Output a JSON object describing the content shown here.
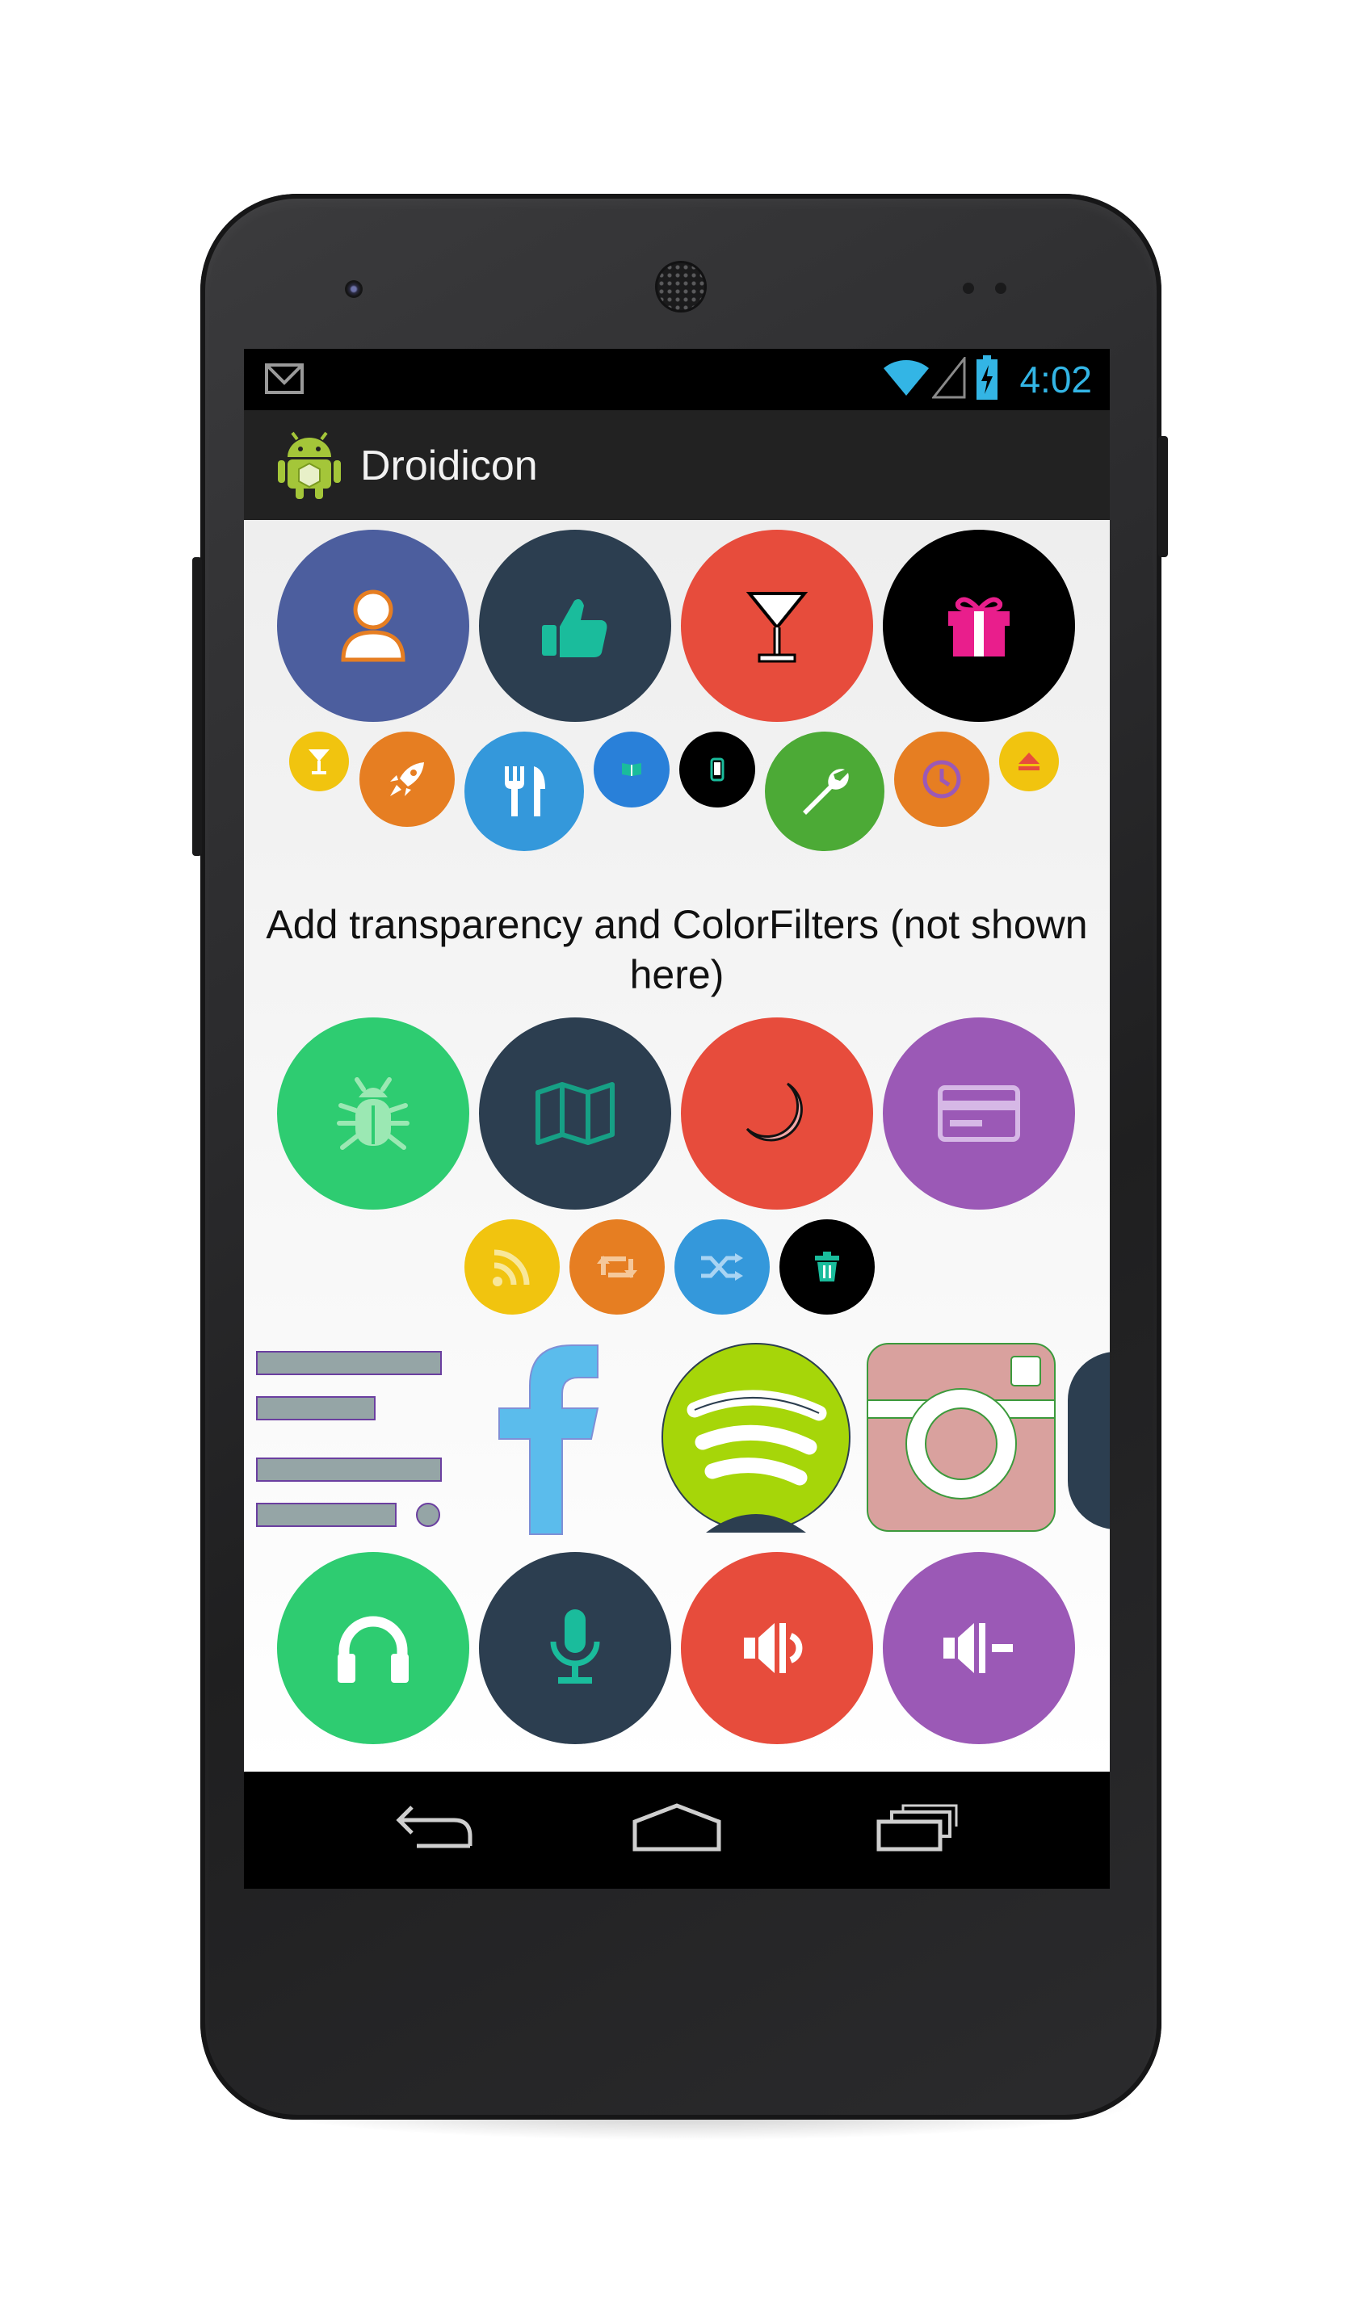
{
  "status_bar": {
    "notification_icon": "gmail-icon",
    "icons": [
      "wifi-icon",
      "signal-icon",
      "battery-charging-icon"
    ],
    "time": "4:02",
    "time_color": "#33b5e5"
  },
  "action_bar": {
    "app_icon": "android-robot-icon",
    "title": "Droidicon"
  },
  "main": {
    "caption": "Add transparency and ColorFilters (not shown here)",
    "rows": {
      "large_row_1": [
        {
          "icon": "user-icon",
          "bg": "#4c5e9e"
        },
        {
          "icon": "thumbs-up-icon",
          "bg": "#2c3e50"
        },
        {
          "icon": "cocktail-icon",
          "bg": "#e74c3c"
        },
        {
          "icon": "gift-icon",
          "bg": "#000000"
        }
      ],
      "small_row_1": [
        {
          "icon": "cocktail-icon",
          "bg": "#f1c40f"
        },
        {
          "icon": "rocket-icon",
          "bg": "#e67e22"
        },
        {
          "icon": "cutlery-icon",
          "bg": "#3498db"
        },
        {
          "icon": "book-icon",
          "bg": "#2980d9"
        },
        {
          "icon": "mobile-icon",
          "bg": "#000000"
        },
        {
          "icon": "wrench-icon",
          "bg": "#4caa36"
        },
        {
          "icon": "clock-icon",
          "bg": "#e67e22"
        },
        {
          "icon": "eject-icon",
          "bg": "#f1c40f"
        }
      ],
      "large_row_2": [
        {
          "icon": "bug-icon",
          "bg": "#2ecc71"
        },
        {
          "icon": "map-icon",
          "bg": "#2c3e50"
        },
        {
          "icon": "moon-icon",
          "bg": "#e74c3c"
        },
        {
          "icon": "credit-card-icon",
          "bg": "#9b59b6"
        }
      ],
      "small_row_2": [
        {
          "icon": "rss-icon",
          "bg": "#f1c40f"
        },
        {
          "icon": "retweet-icon",
          "bg": "#e67e22"
        },
        {
          "icon": "shuffle-icon",
          "bg": "#3498db"
        },
        {
          "icon": "trash-icon",
          "bg": "#000000"
        }
      ],
      "brand_row": [
        "align-left-icon",
        "facebook-icon",
        "spotify-icon",
        "instagram-icon"
      ],
      "large_row_3": [
        {
          "icon": "headphones-icon",
          "bg": "#2ecc71"
        },
        {
          "icon": "microphone-icon",
          "bg": "#2c3e50"
        },
        {
          "icon": "volume-up-icon",
          "bg": "#e74c3c"
        },
        {
          "icon": "volume-down-icon",
          "bg": "#9b59b6"
        }
      ]
    }
  },
  "nav_bar": [
    "back-icon",
    "home-icon",
    "recent-apps-icon"
  ]
}
